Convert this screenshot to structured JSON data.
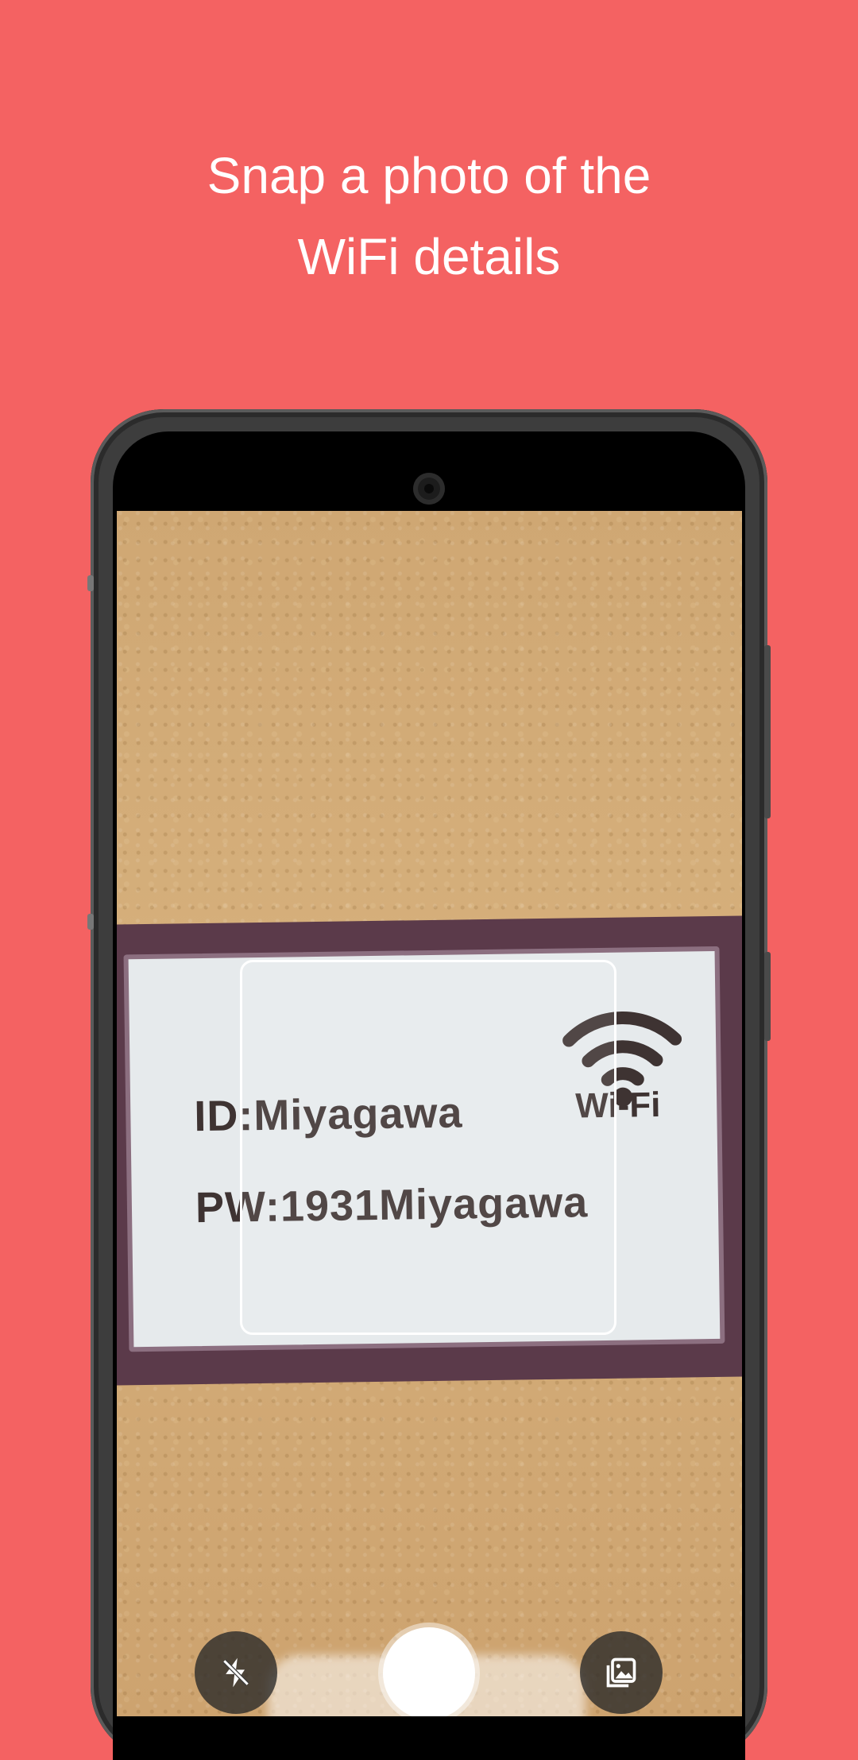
{
  "headline": {
    "line1": "Snap a photo of the",
    "line2": "WiFi details"
  },
  "sign": {
    "id_text": "ID:Miyagawa",
    "pw_text": "PW:1931Miyagawa",
    "wifi_label": "Wi-Fi"
  },
  "controls": {
    "flash_icon": "flash-off-icon",
    "gallery_icon": "gallery-icon",
    "shutter": "shutter-button"
  },
  "colors": {
    "background": "#F46262",
    "headline_text": "#FFFFFF"
  }
}
